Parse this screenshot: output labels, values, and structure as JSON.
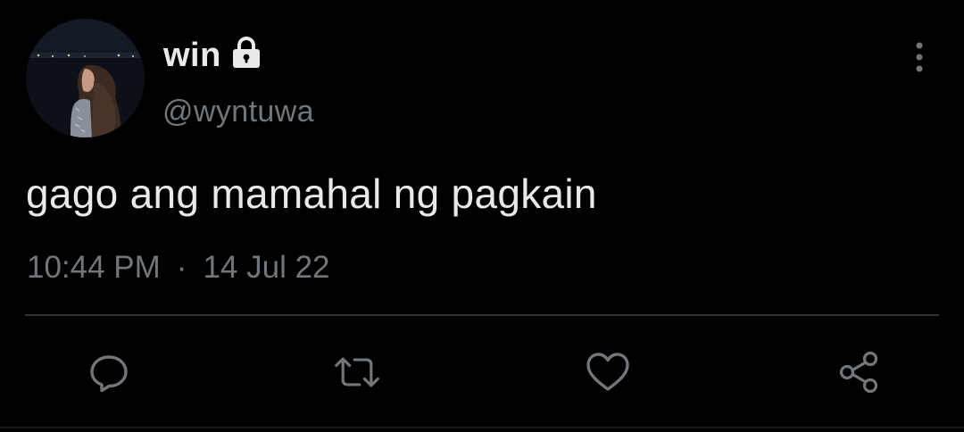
{
  "author": {
    "display_name": "win",
    "handle": "@wyntuwa",
    "protected": true,
    "avatar_icon": "profile-photo-night-scene"
  },
  "tweet": {
    "text": "gago ang mamahal ng pagkain",
    "time": "10:44 PM",
    "separator": "·",
    "date": "14 Jul 22"
  },
  "actions": [
    {
      "name": "reply",
      "icon": "speech-bubble-icon"
    },
    {
      "name": "retweet",
      "icon": "retweet-arrows-icon"
    },
    {
      "name": "like",
      "icon": "heart-icon"
    },
    {
      "name": "share",
      "icon": "share-nodes-icon"
    }
  ],
  "colors": {
    "background": "#000000",
    "primary_text": "#e7e9ea",
    "secondary_text": "#71767b",
    "divider": "#2f3336"
  }
}
